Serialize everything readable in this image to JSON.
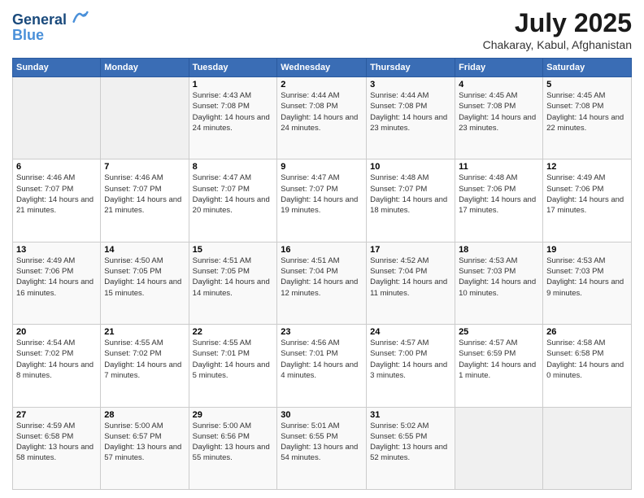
{
  "logo": {
    "line1": "General",
    "line2": "Blue"
  },
  "title": "July 2025",
  "subtitle": "Chakaray, Kabul, Afghanistan",
  "calendar": {
    "headers": [
      "Sunday",
      "Monday",
      "Tuesday",
      "Wednesday",
      "Thursday",
      "Friday",
      "Saturday"
    ],
    "weeks": [
      [
        {
          "day": "",
          "sunrise": "",
          "sunset": "",
          "daylight": ""
        },
        {
          "day": "",
          "sunrise": "",
          "sunset": "",
          "daylight": ""
        },
        {
          "day": "1",
          "sunrise": "Sunrise: 4:43 AM",
          "sunset": "Sunset: 7:08 PM",
          "daylight": "Daylight: 14 hours and 24 minutes."
        },
        {
          "day": "2",
          "sunrise": "Sunrise: 4:44 AM",
          "sunset": "Sunset: 7:08 PM",
          "daylight": "Daylight: 14 hours and 24 minutes."
        },
        {
          "day": "3",
          "sunrise": "Sunrise: 4:44 AM",
          "sunset": "Sunset: 7:08 PM",
          "daylight": "Daylight: 14 hours and 23 minutes."
        },
        {
          "day": "4",
          "sunrise": "Sunrise: 4:45 AM",
          "sunset": "Sunset: 7:08 PM",
          "daylight": "Daylight: 14 hours and 23 minutes."
        },
        {
          "day": "5",
          "sunrise": "Sunrise: 4:45 AM",
          "sunset": "Sunset: 7:08 PM",
          "daylight": "Daylight: 14 hours and 22 minutes."
        }
      ],
      [
        {
          "day": "6",
          "sunrise": "Sunrise: 4:46 AM",
          "sunset": "Sunset: 7:07 PM",
          "daylight": "Daylight: 14 hours and 21 minutes."
        },
        {
          "day": "7",
          "sunrise": "Sunrise: 4:46 AM",
          "sunset": "Sunset: 7:07 PM",
          "daylight": "Daylight: 14 hours and 21 minutes."
        },
        {
          "day": "8",
          "sunrise": "Sunrise: 4:47 AM",
          "sunset": "Sunset: 7:07 PM",
          "daylight": "Daylight: 14 hours and 20 minutes."
        },
        {
          "day": "9",
          "sunrise": "Sunrise: 4:47 AM",
          "sunset": "Sunset: 7:07 PM",
          "daylight": "Daylight: 14 hours and 19 minutes."
        },
        {
          "day": "10",
          "sunrise": "Sunrise: 4:48 AM",
          "sunset": "Sunset: 7:07 PM",
          "daylight": "Daylight: 14 hours and 18 minutes."
        },
        {
          "day": "11",
          "sunrise": "Sunrise: 4:48 AM",
          "sunset": "Sunset: 7:06 PM",
          "daylight": "Daylight: 14 hours and 17 minutes."
        },
        {
          "day": "12",
          "sunrise": "Sunrise: 4:49 AM",
          "sunset": "Sunset: 7:06 PM",
          "daylight": "Daylight: 14 hours and 17 minutes."
        }
      ],
      [
        {
          "day": "13",
          "sunrise": "Sunrise: 4:49 AM",
          "sunset": "Sunset: 7:06 PM",
          "daylight": "Daylight: 14 hours and 16 minutes."
        },
        {
          "day": "14",
          "sunrise": "Sunrise: 4:50 AM",
          "sunset": "Sunset: 7:05 PM",
          "daylight": "Daylight: 14 hours and 15 minutes."
        },
        {
          "day": "15",
          "sunrise": "Sunrise: 4:51 AM",
          "sunset": "Sunset: 7:05 PM",
          "daylight": "Daylight: 14 hours and 14 minutes."
        },
        {
          "day": "16",
          "sunrise": "Sunrise: 4:51 AM",
          "sunset": "Sunset: 7:04 PM",
          "daylight": "Daylight: 14 hours and 12 minutes."
        },
        {
          "day": "17",
          "sunrise": "Sunrise: 4:52 AM",
          "sunset": "Sunset: 7:04 PM",
          "daylight": "Daylight: 14 hours and 11 minutes."
        },
        {
          "day": "18",
          "sunrise": "Sunrise: 4:53 AM",
          "sunset": "Sunset: 7:03 PM",
          "daylight": "Daylight: 14 hours and 10 minutes."
        },
        {
          "day": "19",
          "sunrise": "Sunrise: 4:53 AM",
          "sunset": "Sunset: 7:03 PM",
          "daylight": "Daylight: 14 hours and 9 minutes."
        }
      ],
      [
        {
          "day": "20",
          "sunrise": "Sunrise: 4:54 AM",
          "sunset": "Sunset: 7:02 PM",
          "daylight": "Daylight: 14 hours and 8 minutes."
        },
        {
          "day": "21",
          "sunrise": "Sunrise: 4:55 AM",
          "sunset": "Sunset: 7:02 PM",
          "daylight": "Daylight: 14 hours and 7 minutes."
        },
        {
          "day": "22",
          "sunrise": "Sunrise: 4:55 AM",
          "sunset": "Sunset: 7:01 PM",
          "daylight": "Daylight: 14 hours and 5 minutes."
        },
        {
          "day": "23",
          "sunrise": "Sunrise: 4:56 AM",
          "sunset": "Sunset: 7:01 PM",
          "daylight": "Daylight: 14 hours and 4 minutes."
        },
        {
          "day": "24",
          "sunrise": "Sunrise: 4:57 AM",
          "sunset": "Sunset: 7:00 PM",
          "daylight": "Daylight: 14 hours and 3 minutes."
        },
        {
          "day": "25",
          "sunrise": "Sunrise: 4:57 AM",
          "sunset": "Sunset: 6:59 PM",
          "daylight": "Daylight: 14 hours and 1 minute."
        },
        {
          "day": "26",
          "sunrise": "Sunrise: 4:58 AM",
          "sunset": "Sunset: 6:58 PM",
          "daylight": "Daylight: 14 hours and 0 minutes."
        }
      ],
      [
        {
          "day": "27",
          "sunrise": "Sunrise: 4:59 AM",
          "sunset": "Sunset: 6:58 PM",
          "daylight": "Daylight: 13 hours and 58 minutes."
        },
        {
          "day": "28",
          "sunrise": "Sunrise: 5:00 AM",
          "sunset": "Sunset: 6:57 PM",
          "daylight": "Daylight: 13 hours and 57 minutes."
        },
        {
          "day": "29",
          "sunrise": "Sunrise: 5:00 AM",
          "sunset": "Sunset: 6:56 PM",
          "daylight": "Daylight: 13 hours and 55 minutes."
        },
        {
          "day": "30",
          "sunrise": "Sunrise: 5:01 AM",
          "sunset": "Sunset: 6:55 PM",
          "daylight": "Daylight: 13 hours and 54 minutes."
        },
        {
          "day": "31",
          "sunrise": "Sunrise: 5:02 AM",
          "sunset": "Sunset: 6:55 PM",
          "daylight": "Daylight: 13 hours and 52 minutes."
        },
        {
          "day": "",
          "sunrise": "",
          "sunset": "",
          "daylight": ""
        },
        {
          "day": "",
          "sunrise": "",
          "sunset": "",
          "daylight": ""
        }
      ]
    ]
  }
}
